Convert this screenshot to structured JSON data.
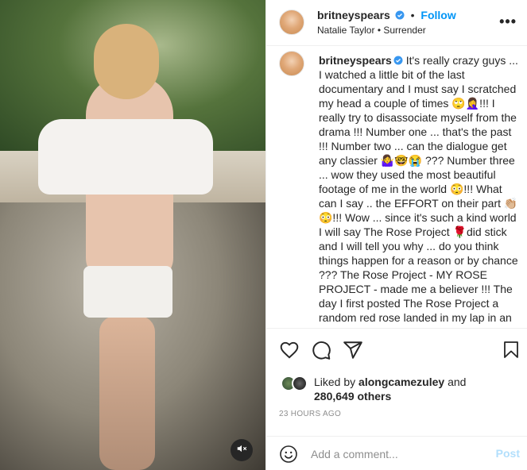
{
  "post": {
    "username": "britneyspears",
    "follow_label": "Follow",
    "audio_artist": "Natalie Taylor",
    "audio_title": "Surrender",
    "more_label": "•••",
    "caption": "It's really crazy guys ... I watched a little bit of the last documentary and I must say I scratched my head a couple of times 🙄🤦‍♀️!!! I really try to disassociate myself from the drama !!! Number one ... that's the past !!! Number two ... can the dialogue get any classier 🤷‍♀️🤓😭 ??? Number three ... wow they used the most beautiful footage of me in the world 😳!!! What can I say .. the EFFORT on their part 👏🏼😳!!! Wow ... since it's such a kind world I will say The Rose Project 🌹did stick and I will tell you why ... do you think things happen for a reason or by chance ??? The Rose Project - MY ROSE PROJECT - made me a believer !!! The day I first posted The Rose Project a random red rose landed in my lap in an airport"
  },
  "likes": {
    "prefix": "Liked by",
    "user": "alongcamezuley",
    "and": "and",
    "count": "280,649 others"
  },
  "timestamp": "23 HOURS AGO",
  "comment": {
    "placeholder": "Add a comment...",
    "post_label": "Post"
  },
  "icons": [
    "heart-icon",
    "comment-icon",
    "share-icon",
    "bookmark-icon",
    "emoji-icon",
    "mute-icon",
    "verified-icon",
    "more-icon"
  ],
  "colors": {
    "accent": "#0095f6",
    "post_disabled": "#b2dffc",
    "text": "#262626",
    "muted": "#8e8e8e"
  }
}
